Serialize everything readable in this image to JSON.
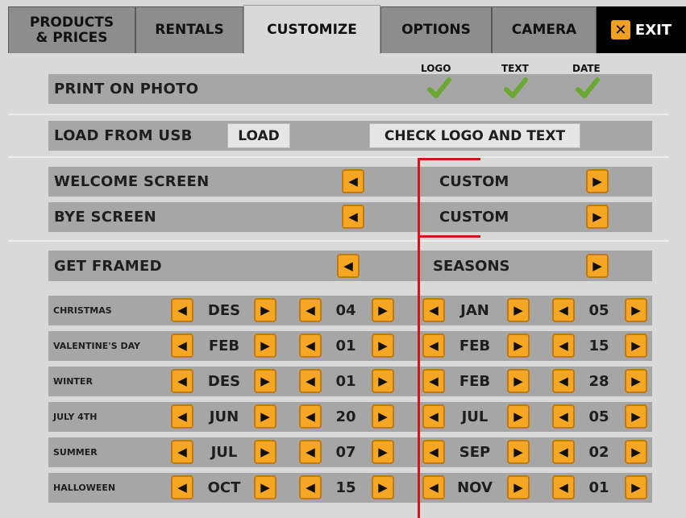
{
  "tabs": [
    {
      "label": "PRODUCTS\n& PRICES"
    },
    {
      "label": "RENTALS"
    },
    {
      "label": "CUSTOMIZE"
    },
    {
      "label": "OPTIONS"
    },
    {
      "label": "CAMERA"
    }
  ],
  "active_tab": "CUSTOMIZE",
  "exit_label": "EXIT",
  "print_on_photo": {
    "label": "PRINT ON PHOTO",
    "options": [
      {
        "label": "LOGO",
        "checked": true
      },
      {
        "label": "TEXT",
        "checked": true
      },
      {
        "label": "DATE",
        "checked": true
      }
    ]
  },
  "load_from_usb": {
    "label": "LOAD FROM USB",
    "load_button": "LOAD",
    "check_button": "CHECK LOGO AND TEXT"
  },
  "welcome_screen": {
    "label": "WELCOME SCREEN",
    "value": "CUSTOM"
  },
  "bye_screen": {
    "label": "BYE SCREEN",
    "value": "CUSTOM"
  },
  "get_framed": {
    "label": "GET FRAMED",
    "value": "SEASONS"
  },
  "seasons": [
    {
      "name": "CHRISTMAS",
      "start_month": "DES",
      "start_day": "04",
      "end_month": "JAN",
      "end_day": "05"
    },
    {
      "name": "VALENTINE'S DAY",
      "start_month": "FEB",
      "start_day": "01",
      "end_month": "FEB",
      "end_day": "15"
    },
    {
      "name": "WINTER",
      "start_month": "DES",
      "start_day": "01",
      "end_month": "FEB",
      "end_day": "28"
    },
    {
      "name": "JULY 4TH",
      "start_month": "JUN",
      "start_day": "20",
      "end_month": "JUL",
      "end_day": "05"
    },
    {
      "name": "SUMMER",
      "start_month": "JUL",
      "start_day": "07",
      "end_month": "SEP",
      "end_day": "02"
    },
    {
      "name": "HALLOWEEN",
      "start_month": "OCT",
      "start_day": "15",
      "end_month": "NOV",
      "end_day": "01"
    }
  ],
  "colors": {
    "arrow": "#f5a623",
    "check": "#6aa832",
    "highlight": "#d01818",
    "bar": "#a6a6a6"
  },
  "icons": {
    "left": "arrow-left-icon",
    "right": "arrow-right-icon",
    "check": "checkmark-icon",
    "exit": "close-icon"
  }
}
